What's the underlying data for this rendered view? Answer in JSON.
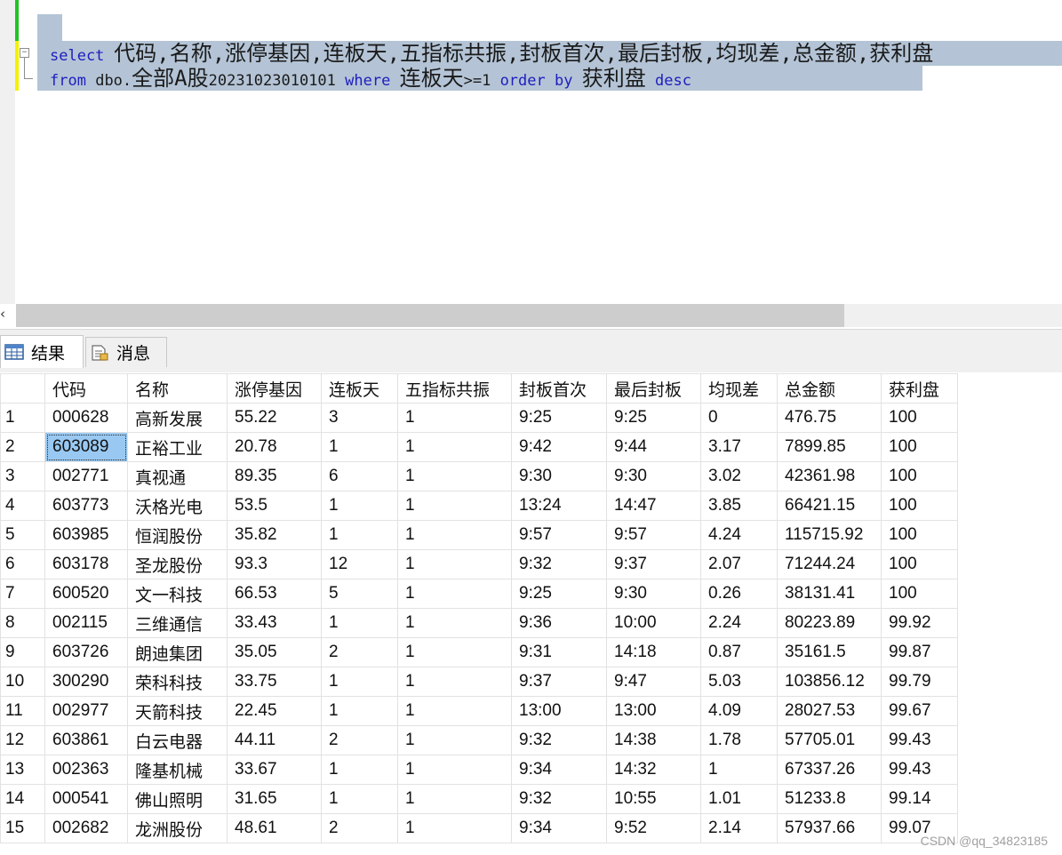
{
  "editor": {
    "line1": {
      "kw_select": "select",
      "columns": "代码,名称,涨停基因,连板天,五指标共振,封板首次,最后封板,均现差,总金额,获利盘"
    },
    "line2": {
      "kw_from": "from",
      "table_prefix": "dbo.",
      "table_name": "全部A股",
      "table_suffix": "20231023010101",
      "kw_where": "where",
      "cond_col": "连板天",
      "cond_op": ">=1",
      "kw_order": "order",
      "kw_by": "by",
      "order_col": "获利盘",
      "kw_desc": "desc"
    },
    "fold_symbol": "−"
  },
  "scrollbar": {
    "left_arrow": "‹"
  },
  "tabs": [
    {
      "label": "结果",
      "icon": "grid-icon"
    },
    {
      "label": "消息",
      "icon": "message-icon"
    }
  ],
  "grid": {
    "columns": [
      "代码",
      "名称",
      "涨停基因",
      "连板天",
      "五指标共振",
      "封板首次",
      "最后封板",
      "均现差",
      "总金额",
      "获利盘"
    ],
    "rows": [
      [
        "1",
        "000628",
        "高新发展",
        "55.22",
        "3",
        "1",
        "9:25",
        "9:25",
        "0",
        "476.75",
        "100"
      ],
      [
        "2",
        "603089",
        "正裕工业",
        "20.78",
        "1",
        "1",
        "9:42",
        "9:44",
        "3.17",
        "7899.85",
        "100"
      ],
      [
        "3",
        "002771",
        "真视通",
        "89.35",
        "6",
        "1",
        "9:30",
        "9:30",
        "3.02",
        "42361.98",
        "100"
      ],
      [
        "4",
        "603773",
        "沃格光电",
        "53.5",
        "1",
        "1",
        "13:24",
        "14:47",
        "3.85",
        "66421.15",
        "100"
      ],
      [
        "5",
        "603985",
        "恒润股份",
        "35.82",
        "1",
        "1",
        "9:57",
        "9:57",
        "4.24",
        "115715.92",
        "100"
      ],
      [
        "6",
        "603178",
        "圣龙股份",
        "93.3",
        "12",
        "1",
        "9:32",
        "9:37",
        "2.07",
        "71244.24",
        "100"
      ],
      [
        "7",
        "600520",
        "文一科技",
        "66.53",
        "5",
        "1",
        "9:25",
        "9:30",
        "0.26",
        "38131.41",
        "100"
      ],
      [
        "8",
        "002115",
        "三维通信",
        "33.43",
        "1",
        "1",
        "9:36",
        "10:00",
        "2.24",
        "80223.89",
        "99.92"
      ],
      [
        "9",
        "603726",
        "朗迪集团",
        "35.05",
        "2",
        "1",
        "9:31",
        "14:18",
        "0.87",
        "35161.5",
        "99.87"
      ],
      [
        "10",
        "300290",
        "荣科科技",
        "33.75",
        "1",
        "1",
        "9:37",
        "9:47",
        "5.03",
        "103856.12",
        "99.79"
      ],
      [
        "11",
        "002977",
        "天箭科技",
        "22.45",
        "1",
        "1",
        "13:00",
        "13:00",
        "4.09",
        "28027.53",
        "99.67"
      ],
      [
        "12",
        "603861",
        "白云电器",
        "44.11",
        "2",
        "1",
        "9:32",
        "14:38",
        "1.78",
        "57705.01",
        "99.43"
      ],
      [
        "13",
        "002363",
        "隆基机械",
        "33.67",
        "1",
        "1",
        "9:34",
        "14:32",
        "1",
        "67337.26",
        "99.43"
      ],
      [
        "14",
        "000541",
        "佛山照明",
        "31.65",
        "1",
        "1",
        "9:32",
        "10:55",
        "1.01",
        "51233.8",
        "99.14"
      ],
      [
        "15",
        "002682",
        "龙洲股份",
        "48.61",
        "2",
        "1",
        "9:34",
        "9:52",
        "2.14",
        "57937.66",
        "99.07"
      ]
    ],
    "selected": {
      "row": 1,
      "col": 1
    }
  },
  "watermark": "CSDN @qq_34823185"
}
